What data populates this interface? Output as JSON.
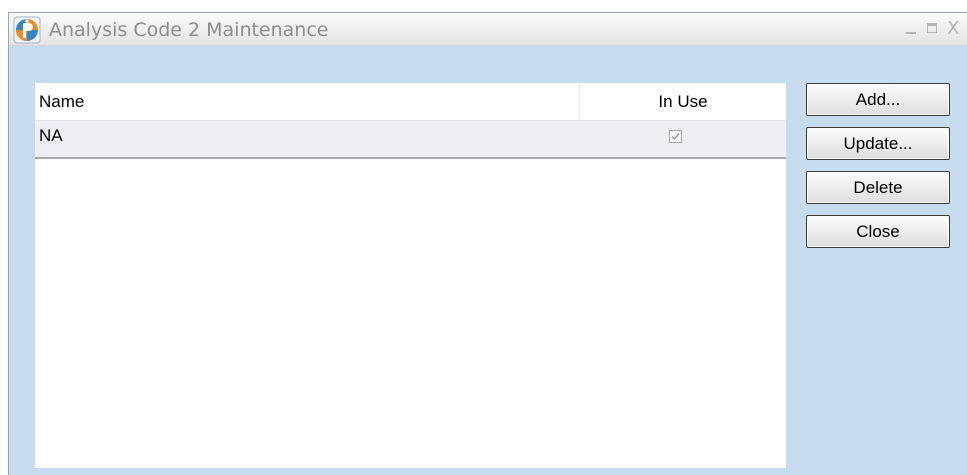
{
  "window": {
    "title": "Analysis Code 2 Maintenance",
    "logo_icon": "app-logo-icon"
  },
  "grid": {
    "columns": [
      "Name",
      "In Use"
    ],
    "rows": [
      {
        "name": "NA",
        "in_use": true
      }
    ]
  },
  "buttons": {
    "add": "Add...",
    "update": "Update...",
    "delete": "Delete",
    "close": "Close"
  },
  "colors": {
    "dialog_background": "#c8dcf0",
    "logo_blue": "#2f86c8",
    "logo_orange": "#f08c1e",
    "selected_row": "#eeedf2"
  }
}
